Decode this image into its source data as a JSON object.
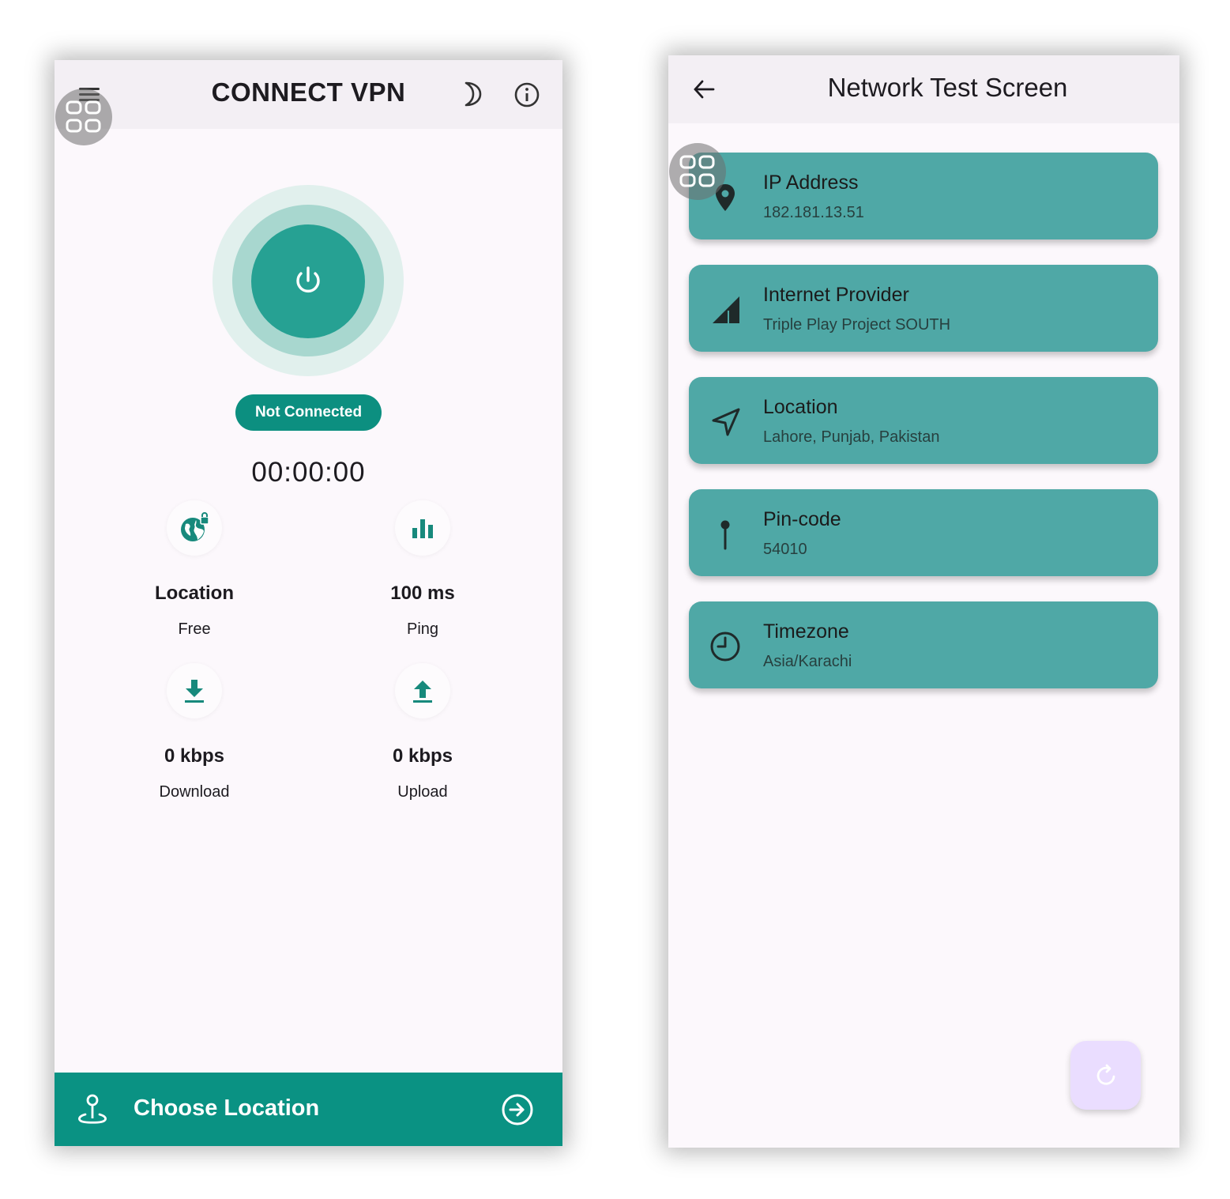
{
  "vpn": {
    "title": "CONNECT VPN",
    "status": "Not Connected",
    "timer": "00:00:00",
    "stats": {
      "location": {
        "value": "Location",
        "label": "Free"
      },
      "ping": {
        "value": "100 ms",
        "label": "Ping"
      },
      "download": {
        "value": "0 kbps",
        "label": "Download"
      },
      "upload": {
        "value": "0 kbps",
        "label": "Upload"
      }
    },
    "choose_location": "Choose Location",
    "icons": [
      "menu-icon",
      "moon-icon",
      "info-icon",
      "power-icon",
      "globe-lock-icon",
      "bar-chart-icon",
      "download-icon",
      "upload-icon",
      "location-pin-icon",
      "arrow-circle-right-icon"
    ],
    "colors": {
      "accent": "#0a9283",
      "power": "#26a193",
      "app_bar": "#f3eff4",
      "background": "#fcf8fc"
    }
  },
  "network": {
    "title": "Network Test Screen",
    "cards": [
      {
        "title": "IP Address",
        "value": "182.181.13.51",
        "icon": "map-pin-icon"
      },
      {
        "title": "Internet Provider",
        "value": "Triple Play Project SOUTH",
        "icon": "signal-icon"
      },
      {
        "title": "Location",
        "value": "Lahore, Punjab, Pakistan",
        "icon": "navigation-arrow-icon"
      },
      {
        "title": "Pin-code",
        "value": "54010",
        "icon": "pushpin-icon"
      },
      {
        "title": "Timezone",
        "value": "Asia/Karachi",
        "icon": "clock-icon"
      }
    ],
    "colors": {
      "card": "#4fa8a6",
      "fab": "#eaddff"
    }
  }
}
